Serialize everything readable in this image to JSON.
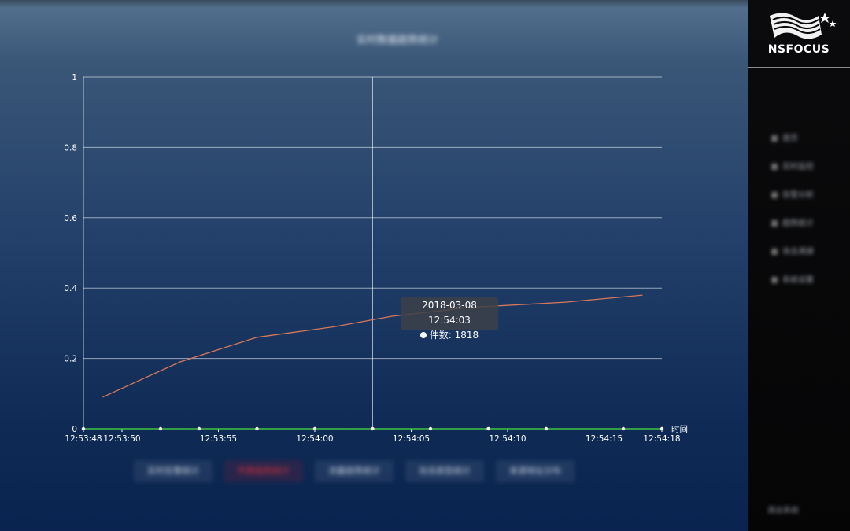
{
  "page": {
    "title": "实时数据趋势统计",
    "tabs": [
      {
        "label": "实时告警统计",
        "active": false
      },
      {
        "label": "件数趋势统计",
        "active": true
      },
      {
        "label": "流量趋势统计",
        "active": false
      },
      {
        "label": "攻击类型统计",
        "active": false
      },
      {
        "label": "来源地址分布",
        "active": false
      }
    ]
  },
  "tooltip": {
    "time": "2018-03-08 12:54:03",
    "series_label": "件数",
    "value_text": "1818"
  },
  "sidebar": {
    "brand": "NSFOCUS",
    "items": [
      {
        "label": "首页"
      },
      {
        "label": "实时监控"
      },
      {
        "label": "告警分析"
      },
      {
        "label": "趋势统计"
      },
      {
        "label": "攻击溯源"
      },
      {
        "label": "系统设置"
      }
    ],
    "bottom_label": "退出系统"
  },
  "chart_data": {
    "type": "line",
    "title": "实时数据趋势统计",
    "xlabel": "时间",
    "ylabel": "",
    "ylim": [
      0,
      1
    ],
    "yticks": [
      "0",
      "0.2",
      "0.4",
      "0.6",
      "0.8",
      "1"
    ],
    "xlim": [
      "12:53:48",
      "12:54:18"
    ],
    "xticks": [
      "12:53:48",
      "12:53:50",
      "12:53:55",
      "12:54:00",
      "12:54:05",
      "12:54:10",
      "12:54:15",
      "12:54:18"
    ],
    "grid": true,
    "hover_x": "12:54:03",
    "series": [
      {
        "name": "件数",
        "color": "#d9775a",
        "x": [
          "12:53:49",
          "12:53:53",
          "12:53:57",
          "12:54:01",
          "12:54:04",
          "12:54:08",
          "12:54:13",
          "12:54:17"
        ],
        "values": [
          0.09,
          0.19,
          0.26,
          0.29,
          0.32,
          0.345,
          0.36,
          0.38
        ]
      },
      {
        "name": "",
        "color": "#3ec43e",
        "x": [
          "12:53:48",
          "12:54:18"
        ],
        "values": [
          0,
          0
        ]
      }
    ],
    "axis_markers_x": [
      "12:53:48",
      "12:53:52",
      "12:53:54",
      "12:53:57",
      "12:54:00",
      "12:54:03",
      "12:54:06",
      "12:54:09",
      "12:54:12",
      "12:54:16",
      "12:54:18"
    ]
  }
}
